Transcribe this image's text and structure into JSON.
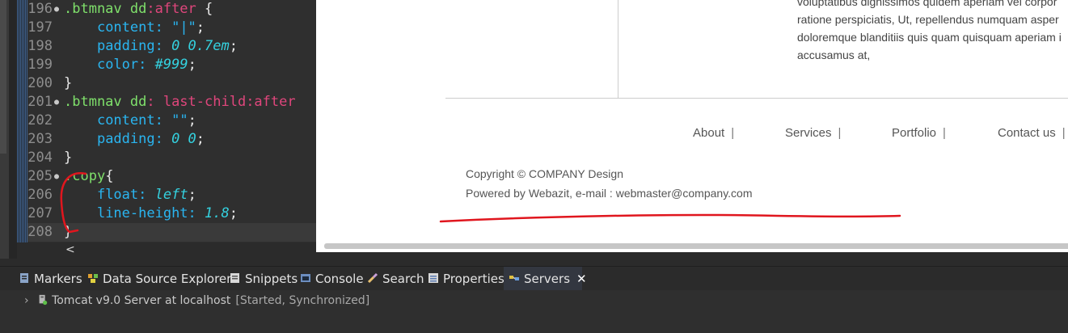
{
  "editor": {
    "lines": [
      {
        "num": "196",
        "fold": "●",
        "tokens": [
          [
            ".btmnav dd",
            "sel"
          ],
          [
            ":after",
            "pseudo"
          ],
          [
            " {",
            "white"
          ]
        ]
      },
      {
        "num": "197",
        "fold": "",
        "tokens": [
          [
            "    ",
            "white"
          ],
          [
            "content: ",
            "prop"
          ],
          [
            "\"|\"",
            "str"
          ],
          [
            ";",
            "white"
          ]
        ]
      },
      {
        "num": "198",
        "fold": "",
        "tokens": [
          [
            "    ",
            "white"
          ],
          [
            "padding: ",
            "prop"
          ],
          [
            "0 0.7em",
            "num"
          ],
          [
            ";",
            "white"
          ]
        ]
      },
      {
        "num": "199",
        "fold": "",
        "tokens": [
          [
            "    ",
            "white"
          ],
          [
            "color: ",
            "prop"
          ],
          [
            "#999",
            "hexv"
          ],
          [
            ";",
            "white"
          ]
        ]
      },
      {
        "num": "200",
        "fold": "",
        "tokens": [
          [
            "}",
            "white"
          ]
        ]
      },
      {
        "num": "201",
        "fold": "●",
        "tokens": [
          [
            ".btmnav dd",
            "sel"
          ],
          [
            ": last-child",
            "pseudo"
          ],
          [
            ":after",
            "pseudo"
          ]
        ]
      },
      {
        "num": "202",
        "fold": "",
        "tokens": [
          [
            "    ",
            "white"
          ],
          [
            "content: ",
            "prop"
          ],
          [
            "\"\"",
            "str"
          ],
          [
            ";",
            "white"
          ]
        ]
      },
      {
        "num": "203",
        "fold": "",
        "tokens": [
          [
            "    ",
            "white"
          ],
          [
            "padding: ",
            "prop"
          ],
          [
            "0 0",
            "num"
          ],
          [
            ";",
            "white"
          ]
        ]
      },
      {
        "num": "204",
        "fold": "",
        "tokens": [
          [
            "}",
            "white"
          ]
        ]
      },
      {
        "num": "205",
        "fold": "●",
        "tokens": [
          [
            ".copy",
            "sel"
          ],
          [
            "{",
            "white"
          ]
        ]
      },
      {
        "num": "206",
        "fold": "",
        "tokens": [
          [
            "    ",
            "white"
          ],
          [
            "float: ",
            "prop"
          ],
          [
            "left",
            "kw"
          ],
          [
            ";",
            "white"
          ]
        ]
      },
      {
        "num": "207",
        "fold": "",
        "tokens": [
          [
            "    ",
            "white"
          ],
          [
            "line-height: ",
            "prop"
          ],
          [
            "1.8",
            "num"
          ],
          [
            ";",
            "white"
          ]
        ]
      },
      {
        "num": "208",
        "fold": "",
        "tokens": [
          [
            "}",
            "white"
          ]
        ],
        "current": true
      }
    ],
    "scroll_arrow": "<"
  },
  "preview": {
    "lorem_lines": [
      "voluptatibus dignissimos quidem aperiam vel corpor",
      "ratione perspiciatis, Ut, repellendus numquam asper",
      "doloremque blanditiis quis quam quisquam aperiam i",
      "accusamus at,"
    ],
    "nav": [
      "About",
      "Services",
      "Portfolio",
      "Contact us"
    ],
    "nav_separator": "|",
    "copyright": "Copyright © COMPANY Design",
    "powered": "Powered by Webazit, e-mail : webmaster@company.com",
    "annotation_color": "#e0161e"
  },
  "panel": {
    "tabs": [
      {
        "label": "Markers",
        "icon": "markers-icon"
      },
      {
        "label": "Data Source Explorer",
        "icon": "data-source-icon"
      },
      {
        "label": "Snippets",
        "icon": "snippets-icon"
      },
      {
        "label": "Console",
        "icon": "console-icon"
      },
      {
        "label": "Search",
        "icon": "search-icon"
      },
      {
        "label": "Properties",
        "icon": "properties-icon"
      },
      {
        "label": "Servers",
        "icon": "servers-icon",
        "active": true
      }
    ],
    "close_glyph": "✕",
    "server": {
      "name": "Tomcat v9.0 Server at localhost",
      "status": "[Started, Synchronized]"
    }
  }
}
